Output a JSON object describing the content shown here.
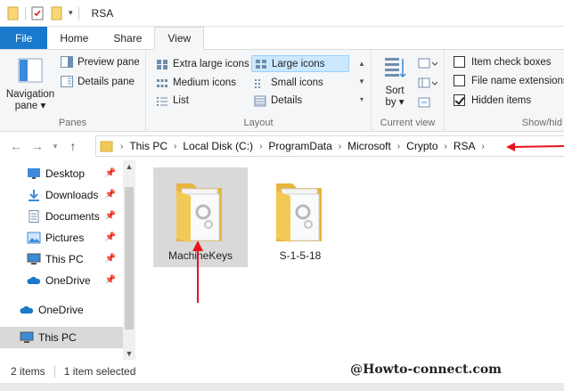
{
  "window": {
    "title": "RSA"
  },
  "tabs": [
    {
      "label": "File"
    },
    {
      "label": "Home"
    },
    {
      "label": "Share"
    },
    {
      "label": "View"
    }
  ],
  "ribbon": {
    "panes": {
      "label": "Panes",
      "navigation_pane": "Navigation",
      "navigation_pane_line2": "pane ▾",
      "preview_pane": "Preview pane",
      "details_pane": "Details pane"
    },
    "layout": {
      "label": "Layout",
      "extra_large": "Extra large icons",
      "large": "Large icons",
      "medium": "Medium icons",
      "small": "Small icons",
      "list": "List",
      "details": "Details"
    },
    "current_view": {
      "label": "Current view",
      "sort": "Sort",
      "sort_line2": "by ▾"
    },
    "show_hide": {
      "label": "Show/hid",
      "item_check_boxes": "Item check boxes",
      "file_name_extensions": "File name extensions",
      "hidden_items": "Hidden items"
    }
  },
  "address": {
    "crumbs": [
      "This PC",
      "Local Disk (C:)",
      "ProgramData",
      "Microsoft",
      "Crypto",
      "RSA"
    ]
  },
  "nav_pane": {
    "items": [
      {
        "label": "Desktop"
      },
      {
        "label": "Downloads"
      },
      {
        "label": "Documents"
      },
      {
        "label": "Pictures"
      },
      {
        "label": "This PC"
      },
      {
        "label": "OneDrive"
      },
      {
        "label": "OneDrive"
      },
      {
        "label": "This PC"
      }
    ]
  },
  "files": [
    {
      "name": "MachineKeys"
    },
    {
      "name": "S-1-5-18"
    }
  ],
  "status": {
    "count": "2 items",
    "selected": "1 item selected"
  },
  "watermark": "@Howto-connect.com",
  "colors": {
    "accent": "#1979ca",
    "selection": "#cce8ff",
    "folder": "#f3c955",
    "annotation": "#e8141e"
  }
}
